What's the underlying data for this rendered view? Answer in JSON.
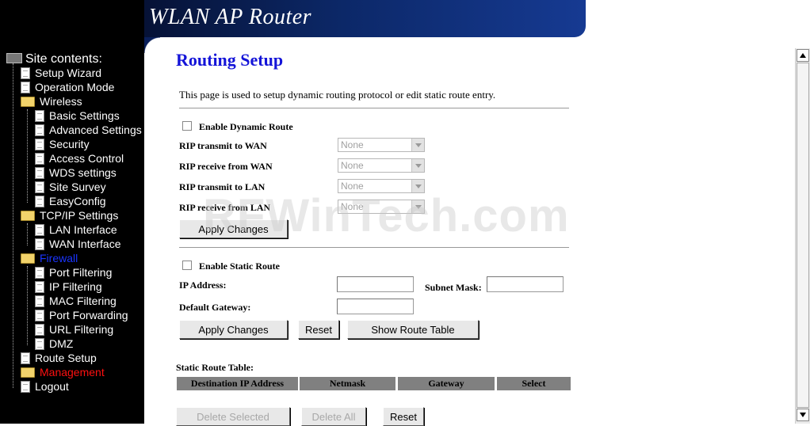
{
  "header": {
    "title": "WLAN AP Router"
  },
  "sidebar": {
    "title": "Site contents:",
    "items": [
      {
        "label": "Setup Wizard"
      },
      {
        "label": "Operation Mode"
      },
      {
        "label": "Wireless"
      },
      {
        "label": "Basic Settings"
      },
      {
        "label": "Advanced Settings"
      },
      {
        "label": "Security"
      },
      {
        "label": "Access Control"
      },
      {
        "label": "WDS settings"
      },
      {
        "label": "Site Survey"
      },
      {
        "label": "EasyConfig"
      },
      {
        "label": "TCP/IP Settings"
      },
      {
        "label": "LAN Interface"
      },
      {
        "label": "WAN Interface"
      },
      {
        "label": "Firewall"
      },
      {
        "label": "Port Filtering"
      },
      {
        "label": "IP Filtering"
      },
      {
        "label": "MAC Filtering"
      },
      {
        "label": "Port Forwarding"
      },
      {
        "label": "URL Filtering"
      },
      {
        "label": "DMZ"
      },
      {
        "label": "Route Setup"
      },
      {
        "label": "Management"
      },
      {
        "label": "Logout"
      }
    ]
  },
  "page": {
    "title": "Routing Setup",
    "description": "This page is used to setup dynamic routing protocol or edit static route entry."
  },
  "dynamic": {
    "enable_label": "Enable Dynamic Route",
    "enabled": false,
    "rip_tx_wan_label": "RIP transmit to WAN",
    "rip_rx_wan_label": "RIP receive from WAN",
    "rip_tx_lan_label": "RIP transmit to LAN",
    "rip_rx_lan_label": "RIP receive from LAN",
    "rip_tx_wan_value": "None",
    "rip_rx_wan_value": "None",
    "rip_tx_lan_value": "None",
    "rip_rx_lan_value": "None",
    "apply_label": "Apply Changes"
  },
  "static": {
    "enable_label": "Enable Static Route",
    "enabled": false,
    "ip_label": "IP Address:",
    "mask_label": "Subnet Mask:",
    "gateway_label": "Default Gateway:",
    "ip_value": "",
    "mask_value": "",
    "gateway_value": "",
    "apply_label": "Apply Changes",
    "reset_label": "Reset",
    "show_table_label": "Show Route Table"
  },
  "table": {
    "title": "Static Route Table:",
    "columns": [
      "Destination IP Address",
      "Netmask",
      "Gateway",
      "Select"
    ],
    "rows": []
  },
  "table_actions": {
    "delete_selected_label": "Delete Selected",
    "delete_all_label": "Delete All",
    "reset_label": "Reset"
  },
  "watermark": "RFWinTech.com",
  "colors": {
    "page_title": "#1414d8",
    "nav_active": "#1a35ff",
    "nav_highlight": "#ff1010",
    "table_header": "#808080",
    "banner": "#0c2868"
  }
}
